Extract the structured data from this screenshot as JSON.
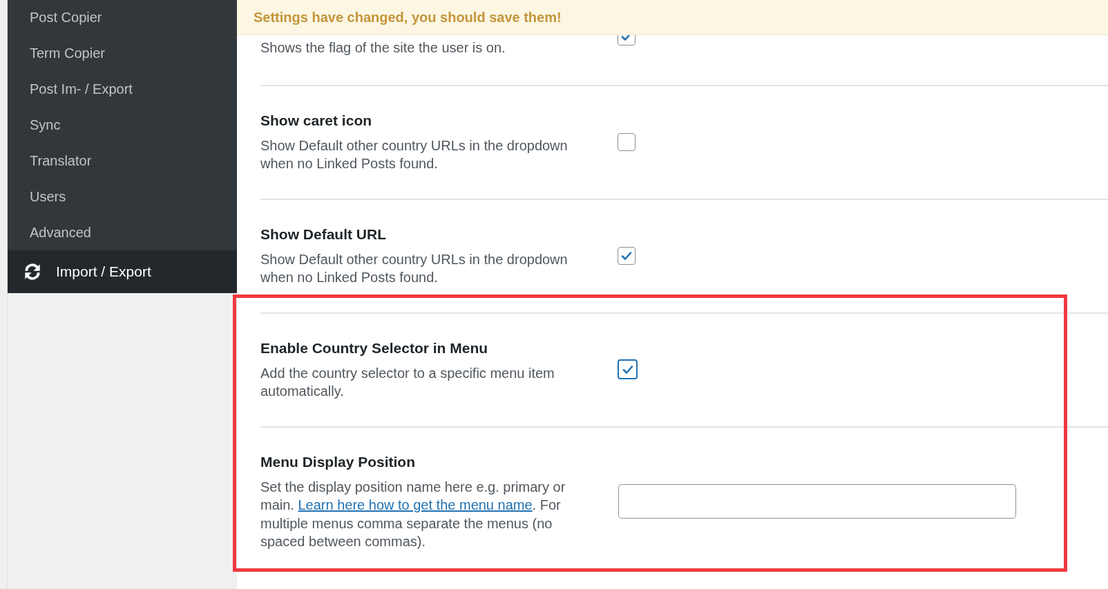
{
  "sidebar": {
    "items": [
      {
        "label": "Post Copier",
        "selected": false,
        "icon": false
      },
      {
        "label": "Term Copier",
        "selected": false,
        "icon": false
      },
      {
        "label": "Post Im- / Export",
        "selected": false,
        "icon": false
      },
      {
        "label": "Sync",
        "selected": false,
        "icon": false
      },
      {
        "label": "Translator",
        "selected": false,
        "icon": false
      },
      {
        "label": "Users",
        "selected": false,
        "icon": false
      },
      {
        "label": "Advanced",
        "selected": false,
        "icon": false
      },
      {
        "label": "Import / Export",
        "selected": true,
        "icon": true
      }
    ]
  },
  "notice": {
    "text": "Settings have changed, you should save them!"
  },
  "settings": [
    {
      "kind": "checkbox",
      "description": [
        {
          "kind": "text",
          "text": "Shows the flag of the site the user is on."
        }
      ],
      "checked": true
    },
    {
      "kind": "checkbox",
      "title": "Show caret icon",
      "description": [
        {
          "kind": "text",
          "text": "Show Default other country URLs in the dropdown when no Linked Posts found."
        }
      ],
      "checked": false
    },
    {
      "kind": "checkbox",
      "title": "Show Default URL",
      "description": [
        {
          "kind": "text",
          "text": "Show Default other country URLs in the dropdown when no Linked Posts found."
        }
      ],
      "checked": true
    },
    {
      "kind": "checkbox",
      "title": "Enable Country Selector in Menu",
      "description": [
        {
          "kind": "text",
          "text": "Add the country selector to a specific menu item automatically."
        }
      ],
      "checked": true,
      "focused": true,
      "highlighted": true
    },
    {
      "kind": "text",
      "title": "Menu Display Position",
      "description": [
        {
          "kind": "text",
          "text": "Set the display position name here e.g. primary or main. "
        },
        {
          "kind": "link",
          "text": "Learn here how to get the menu name"
        },
        {
          "kind": "text",
          "text": ". For multiple menus comma separate the menus (no spaced between commas)."
        }
      ],
      "highlighted": true
    }
  ]
}
